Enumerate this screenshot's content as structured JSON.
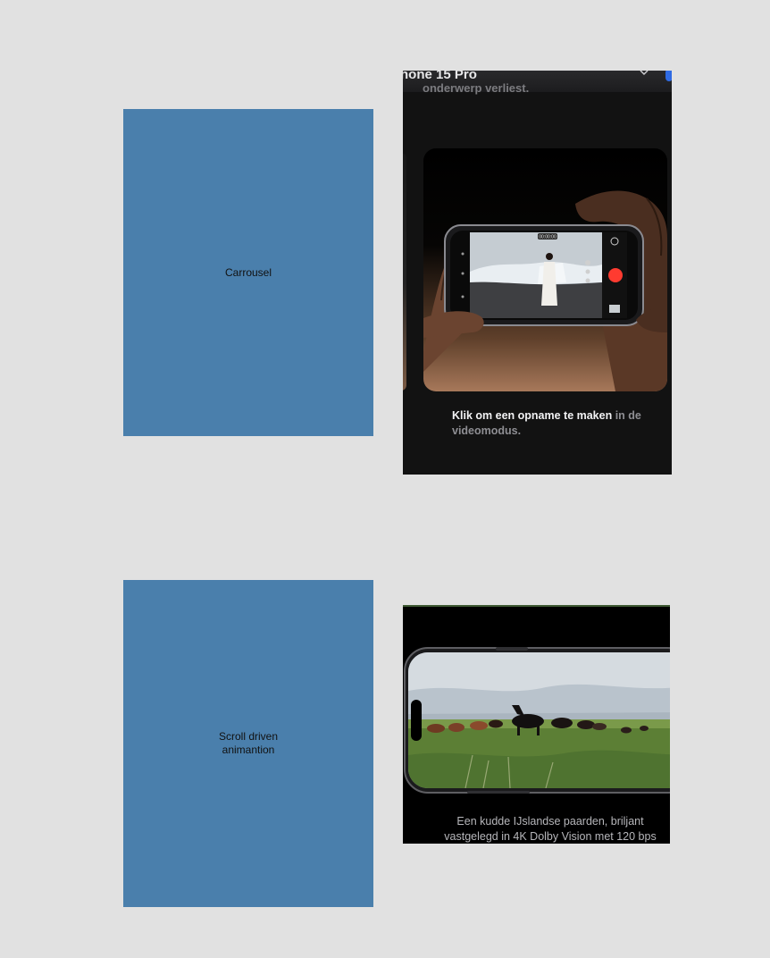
{
  "placeholders": {
    "carousel": "Carrousel",
    "scroll_line1": "Scroll driven",
    "scroll_line2": "animantion"
  },
  "carousel_screenshot": {
    "title": "hone 15 Pro",
    "subtitle": "onderwerp verliest.",
    "caption_strong": "Klik om een opname te maken",
    "caption_dim": " in de videomodus.",
    "record_time": "00:00:00",
    "accent_color": "#2f6be3",
    "record_color": "#ff3b30"
  },
  "scroll_screenshot": {
    "caption_line1": "Een kudde IJslandse paarden, briljant",
    "caption_line2": "vastgelegd in 4K Dolby Vision met 120 bps"
  },
  "colors": {
    "background": "#e1e1e1",
    "placeholder": "#4a7fac"
  }
}
